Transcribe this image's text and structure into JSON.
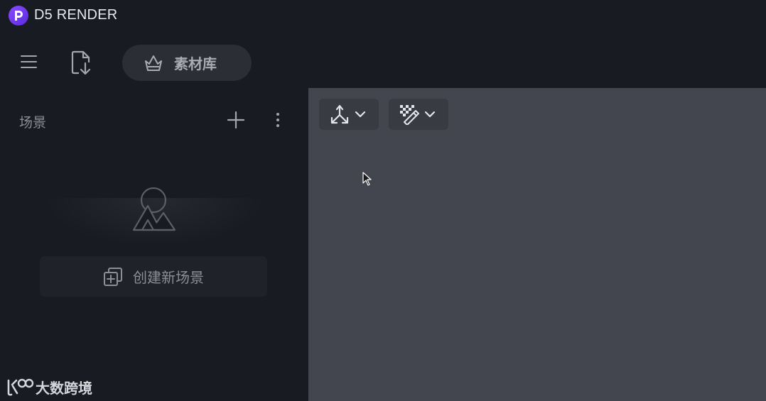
{
  "app": {
    "title": "D5 RENDER",
    "logo_icon": "d5-logo-icon"
  },
  "toolbar": {
    "menu_icon": "hamburger-menu-icon",
    "import_icon": "file-import-icon",
    "assets_label": "素材库",
    "assets_icon": "asset-library-icon"
  },
  "sidebar": {
    "title": "场景",
    "add_icon": "plus-icon",
    "more_icon": "more-vertical-icon",
    "empty_icon": "mountain-sun-icon",
    "create_label": "创建新场景",
    "create_icon": "add-copy-icon"
  },
  "viewport": {
    "transform_icon": "transform-axes-icon",
    "magic_icon": "checkered-magic-wand-icon",
    "chevron_icon": "chevron-down-icon"
  },
  "watermark": {
    "text": "大数跨境"
  },
  "colors": {
    "background": "#181b22",
    "viewport": "#43464e",
    "accent": "#7b3ff2",
    "panel_button": "#2b2e35"
  }
}
